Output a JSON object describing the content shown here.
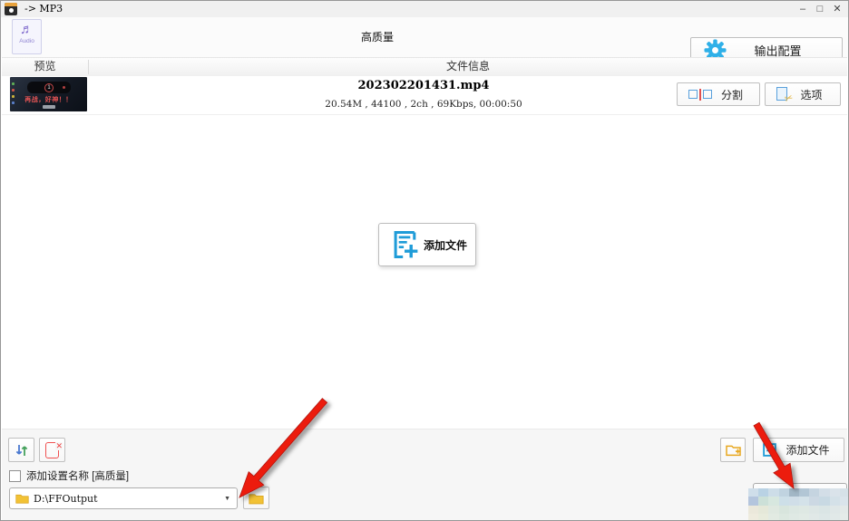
{
  "window": {
    "title": "-> MP3"
  },
  "controls": {
    "minimize": "–",
    "maximize": "□",
    "close": "✕"
  },
  "toolbar": {
    "audio_note": "♬",
    "audio_label": "Audio",
    "quality": "高质量",
    "output_config": "输出配置"
  },
  "table": {
    "preview_header": "预览",
    "info_header": "文件信息"
  },
  "file": {
    "name": "202302201431.mp4",
    "details": "20.54M , 44100 , 2ch , 69Kbps, 00:00:50",
    "split": "分割",
    "options": "选项",
    "thumb_badge": "1",
    "thumb_caption": "再战，好神！！"
  },
  "center": {
    "add_files": "添加文件"
  },
  "bottom": {
    "checkbox_label": "添加设置名称 [高质量]",
    "output_path": "D:\\FFOutput",
    "dropdown_arrow": "▼",
    "add_files": "添加文件"
  },
  "colors": {
    "accent_blue": "#1f9cd8",
    "folder_yellow": "#f2c235",
    "arrow_red": "#ec1c0e"
  },
  "censor": {
    "cell_w": 11.2,
    "cell_h": 9.3,
    "rows": [
      [
        "#cfdeea",
        "#b9d2e4",
        "#cddde8",
        "#c0d3e0",
        "#a2b7c6",
        "#b2c6d5",
        "#c5d4e0",
        "#d3dee7",
        "#dae3ea",
        "#d6e1e8"
      ],
      [
        "#b4c5dd",
        "#cce0d8",
        "#d7e7df",
        "#cddfe8",
        "#d0dee8",
        "#d4e2e9",
        "#ccd8e3",
        "#c8d9e3",
        "#d4e1e8",
        "#dae4eb"
      ],
      [
        "#ebe8db",
        "#e5e8d9",
        "#dfe8e0",
        "#d8e5dd",
        "#dce7e2",
        "#dee8e3",
        "#dde6e5",
        "#dae5e5",
        "#dfe7e7",
        "#e3e9e8"
      ],
      [
        "#eeebde",
        "#e8ebdc",
        "#e2eae2",
        "#dce8e0",
        "#dfe9e4",
        "#e1eae5",
        "#e0e8e7",
        "#dde7e7",
        "#e1e9e8",
        "#e5ebe9"
      ]
    ]
  }
}
